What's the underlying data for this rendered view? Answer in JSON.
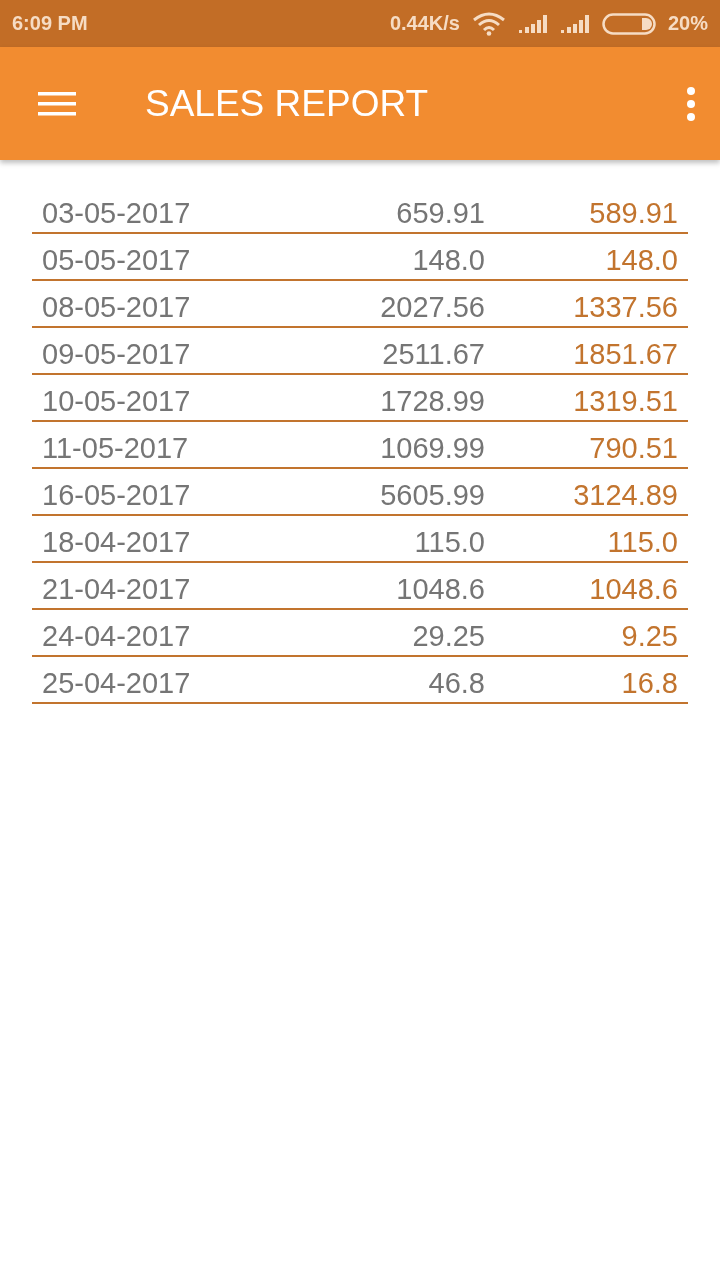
{
  "status_bar": {
    "time": "6:09 PM",
    "speed": "0.44K/s",
    "battery": "20%"
  },
  "app_bar": {
    "title": "SALES REPORT"
  },
  "table": {
    "rows": [
      {
        "column_1": "03-05-2017",
        "column_2": "659.91",
        "column_3": "589.91"
      },
      {
        "column_1": "05-05-2017",
        "column_2": "148.0",
        "column_3": "148.0"
      },
      {
        "column_1": "08-05-2017",
        "column_2": "2027.56",
        "column_3": "1337.56"
      },
      {
        "column_1": "09-05-2017",
        "column_2": "2511.67",
        "column_3": "1851.67"
      },
      {
        "column_1": "10-05-2017",
        "column_2": "1728.99",
        "column_3": "1319.51"
      },
      {
        "column_1": "11-05-2017",
        "column_2": "1069.99",
        "column_3": "790.51"
      },
      {
        "column_1": "16-05-2017",
        "column_2": "5605.99",
        "column_3": "3124.89"
      },
      {
        "column_1": "18-04-2017",
        "column_2": "115.0",
        "column_3": "115.0"
      },
      {
        "column_1": "21-04-2017",
        "column_2": "1048.6",
        "column_3": "1048.6"
      },
      {
        "column_1": "24-04-2017",
        "column_2": "29.25",
        "column_3": "9.25"
      },
      {
        "column_1": "25-04-2017",
        "column_2": "46.8",
        "column_3": "16.8"
      }
    ]
  }
}
